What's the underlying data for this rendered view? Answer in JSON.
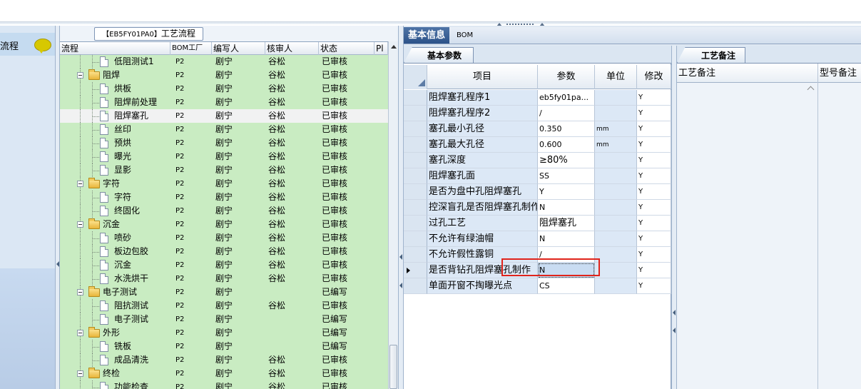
{
  "left_nav": {
    "item_label": "流程"
  },
  "tree": {
    "title_code": "【EB5FY01PA0】",
    "title_text": "工艺流程",
    "columns": [
      "流程",
      "BOM工厂",
      "编写人",
      "核审人",
      "状态",
      "Pl"
    ],
    "rows": [
      {
        "name": "低阻测试1",
        "factory": "P2",
        "writer": "剧宁",
        "reviewer": "谷松",
        "status": "已审核",
        "level": 1,
        "kind": "doc"
      },
      {
        "name": "阻焊",
        "factory": "P2",
        "writer": "剧宁",
        "reviewer": "谷松",
        "status": "已审核",
        "level": 0,
        "kind": "folder"
      },
      {
        "name": "烘板",
        "factory": "P2",
        "writer": "剧宁",
        "reviewer": "谷松",
        "status": "已审核",
        "level": 1,
        "kind": "doc"
      },
      {
        "name": "阻焊前处理",
        "factory": "P2",
        "writer": "剧宁",
        "reviewer": "谷松",
        "status": "已审核",
        "level": 1,
        "kind": "doc"
      },
      {
        "name": "阻焊塞孔",
        "factory": "P2",
        "writer": "剧宁",
        "reviewer": "谷松",
        "status": "已审核",
        "level": 1,
        "kind": "doc",
        "selected": true
      },
      {
        "name": "丝印",
        "factory": "P2",
        "writer": "剧宁",
        "reviewer": "谷松",
        "status": "已审核",
        "level": 1,
        "kind": "doc"
      },
      {
        "name": "预烘",
        "factory": "P2",
        "writer": "剧宁",
        "reviewer": "谷松",
        "status": "已审核",
        "level": 1,
        "kind": "doc"
      },
      {
        "name": "曝光",
        "factory": "P2",
        "writer": "剧宁",
        "reviewer": "谷松",
        "status": "已审核",
        "level": 1,
        "kind": "doc"
      },
      {
        "name": "显影",
        "factory": "P2",
        "writer": "剧宁",
        "reviewer": "谷松",
        "status": "已审核",
        "level": 1,
        "kind": "doc"
      },
      {
        "name": "字符",
        "factory": "P2",
        "writer": "剧宁",
        "reviewer": "谷松",
        "status": "已审核",
        "level": 0,
        "kind": "folder"
      },
      {
        "name": "字符",
        "factory": "P2",
        "writer": "剧宁",
        "reviewer": "谷松",
        "status": "已审核",
        "level": 1,
        "kind": "doc"
      },
      {
        "name": "终固化",
        "factory": "P2",
        "writer": "剧宁",
        "reviewer": "谷松",
        "status": "已审核",
        "level": 1,
        "kind": "doc"
      },
      {
        "name": "沉金",
        "factory": "P2",
        "writer": "剧宁",
        "reviewer": "谷松",
        "status": "已审核",
        "level": 0,
        "kind": "folder"
      },
      {
        "name": "喷砂",
        "factory": "P2",
        "writer": "剧宁",
        "reviewer": "谷松",
        "status": "已审核",
        "level": 1,
        "kind": "doc"
      },
      {
        "name": "板边包胶",
        "factory": "P2",
        "writer": "剧宁",
        "reviewer": "谷松",
        "status": "已审核",
        "level": 1,
        "kind": "doc"
      },
      {
        "name": "沉金",
        "factory": "P2",
        "writer": "剧宁",
        "reviewer": "谷松",
        "status": "已审核",
        "level": 1,
        "kind": "doc"
      },
      {
        "name": "水洗烘干",
        "factory": "P2",
        "writer": "剧宁",
        "reviewer": "谷松",
        "status": "已审核",
        "level": 1,
        "kind": "doc"
      },
      {
        "name": "电子测试",
        "factory": "P2",
        "writer": "剧宁",
        "reviewer": "",
        "status": "已编写",
        "level": 0,
        "kind": "folder"
      },
      {
        "name": "阻抗测试",
        "factory": "P2",
        "writer": "剧宁",
        "reviewer": "谷松",
        "status": "已审核",
        "level": 1,
        "kind": "doc"
      },
      {
        "name": "电子测试",
        "factory": "P2",
        "writer": "剧宁",
        "reviewer": "",
        "status": "已编写",
        "level": 1,
        "kind": "doc"
      },
      {
        "name": "外形",
        "factory": "P2",
        "writer": "剧宁",
        "reviewer": "",
        "status": "已编写",
        "level": 0,
        "kind": "folder"
      },
      {
        "name": "铣板",
        "factory": "P2",
        "writer": "剧宁",
        "reviewer": "",
        "status": "已编写",
        "level": 1,
        "kind": "doc"
      },
      {
        "name": "成品清洗",
        "factory": "P2",
        "writer": "剧宁",
        "reviewer": "谷松",
        "status": "已审核",
        "level": 1,
        "kind": "doc"
      },
      {
        "name": "终检",
        "factory": "P2",
        "writer": "剧宁",
        "reviewer": "谷松",
        "status": "已审核",
        "level": 0,
        "kind": "folder"
      },
      {
        "name": "功能检查",
        "factory": "P2",
        "writer": "剧宁",
        "reviewer": "谷松",
        "status": "已审核",
        "level": 1,
        "kind": "doc"
      }
    ]
  },
  "tabs": [
    {
      "label": "基本信息",
      "active": true
    },
    {
      "label": "BOM",
      "active": false
    }
  ],
  "params": {
    "tab_label": "基本参数",
    "columns": {
      "item": "项目",
      "param": "参数",
      "unit": "单位",
      "mod": "修改"
    },
    "rows": [
      {
        "item": "阻焊塞孔程序1",
        "param": "eb5fy01pa...",
        "unit": "",
        "mod": "Y"
      },
      {
        "item": "阻焊塞孔程序2",
        "param": "/",
        "unit": "",
        "mod": "Y"
      },
      {
        "item": "塞孔最小孔径",
        "param": "0.350",
        "unit": "mm",
        "mod": "Y"
      },
      {
        "item": "塞孔最大孔径",
        "param": "0.600",
        "unit": "mm",
        "mod": "Y"
      },
      {
        "item": "塞孔深度",
        "param": "≥80%",
        "unit": "",
        "mod": "Y"
      },
      {
        "item": "阻焊塞孔面",
        "param": "SS",
        "unit": "",
        "mod": "Y"
      },
      {
        "item": "是否为盘中孔阻焊塞孔",
        "param": "Y",
        "unit": "",
        "mod": "Y"
      },
      {
        "item": "控深盲孔是否阻焊塞孔制作",
        "param": "N",
        "unit": "",
        "mod": "Y"
      },
      {
        "item": "过孔工艺",
        "param": "阻焊塞孔",
        "unit": "",
        "mod": "Y"
      },
      {
        "item": "不允许有绿油帽",
        "param": "N",
        "unit": "",
        "mod": "Y"
      },
      {
        "item": "不允许假性露铜",
        "param": "/",
        "unit": "",
        "mod": "Y"
      },
      {
        "item": "是否背钻孔阻焊塞孔制作",
        "param": "N",
        "unit": "",
        "mod": "Y",
        "current": true
      },
      {
        "item": "单面开窗不掏曝光点",
        "param": "CS",
        "unit": "",
        "mod": "Y"
      }
    ]
  },
  "notes": {
    "tab_label": "工艺备注",
    "col1": "工艺备注",
    "col2": "型号备注"
  }
}
